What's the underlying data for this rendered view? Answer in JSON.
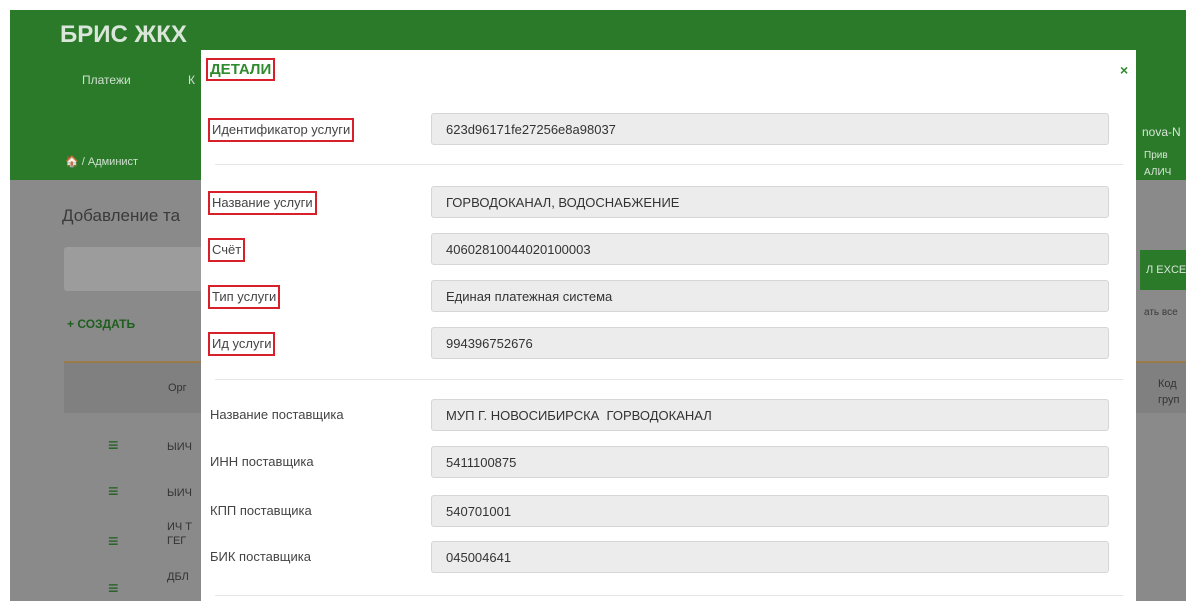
{
  "background": {
    "brand": "БРИС ЖКХ",
    "nav": [
      "Платежи",
      "К"
    ],
    "user_fragment": "nova-N",
    "breadcrumb": "🏠 / Админист",
    "side_links": [
      "Прив",
      "АЛИЧ"
    ],
    "page_title": "Добавление та",
    "create_button": "+ СОЗДАТЬ",
    "excel_button": "Л EXCE",
    "select_all": "ать все",
    "table": {
      "header_left": "Орг",
      "header_right": [
        "Код",
        "груп"
      ],
      "rows": [
        {
          "text": [
            "ЫИЧ"
          ]
        },
        {
          "text": [
            "ЫИЧ"
          ]
        },
        {
          "text": [
            "ИЧ Т",
            "ГЕГ"
          ]
        },
        {
          "text": [
            "ДБЛ"
          ]
        }
      ]
    }
  },
  "modal": {
    "title": "ДЕТАЛИ",
    "close_label": "×",
    "fields": [
      {
        "label": "Идентификатор услуги",
        "value": "623d96171fe27256e8a98037"
      },
      {
        "label": "Название услуги",
        "value": "ГОРВОДОКАНАЛ, ВОДОСНАБЖЕНИЕ"
      },
      {
        "label": "Счёт",
        "value": "40602810044020100003"
      },
      {
        "label": "Тип услуги",
        "value": "Единая платежная система"
      },
      {
        "label": "Ид услуги",
        "value": "994396752676"
      },
      {
        "label": "Название поставщика",
        "value": "МУП Г. НОВОСИБИРСКА  ГОРВОДОКАНАЛ"
      },
      {
        "label": "ИНН поставщика",
        "value": "5411100875"
      },
      {
        "label": "КПП поставщика",
        "value": "540701001"
      },
      {
        "label": "БИК поставщика",
        "value": "045004641"
      }
    ]
  }
}
